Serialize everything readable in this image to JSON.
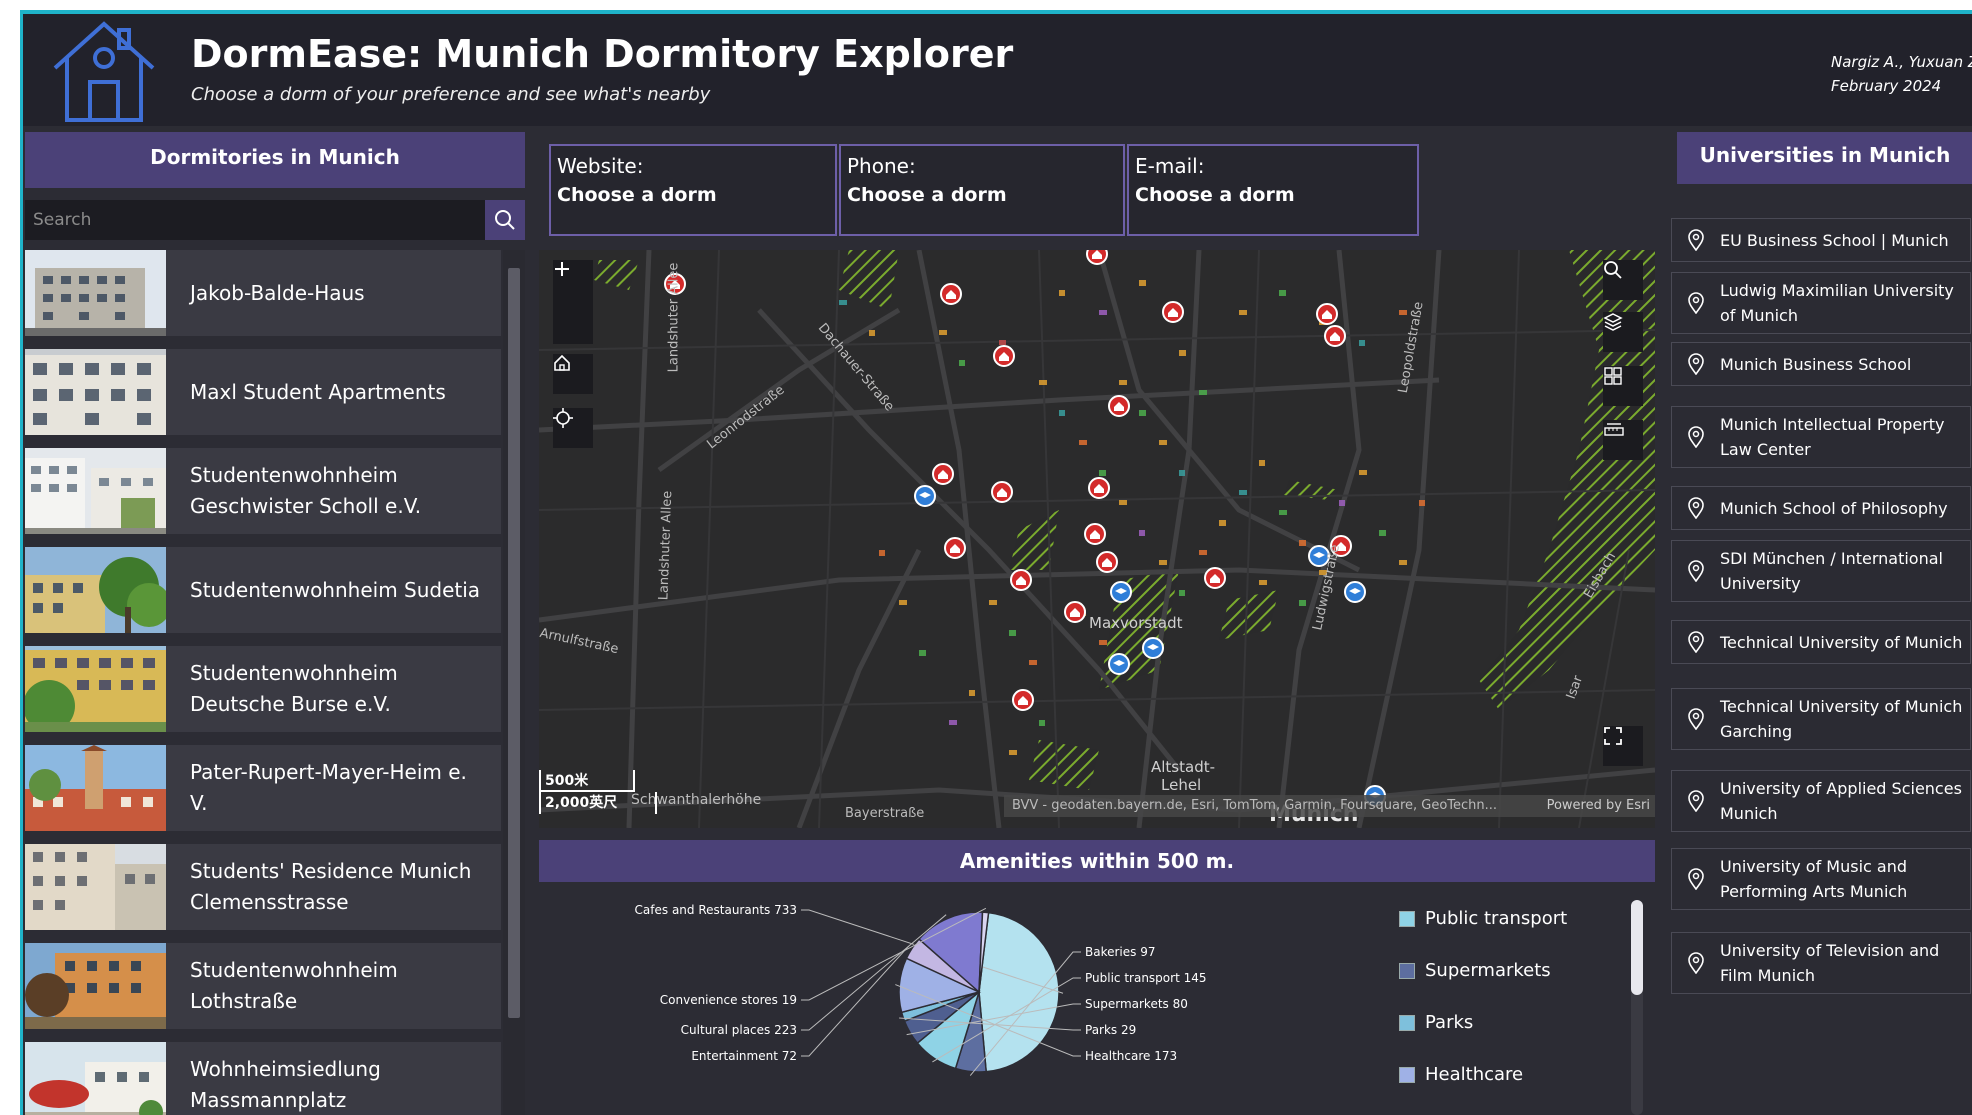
{
  "header": {
    "title": "DormEase: Munich Dormitory Explorer",
    "subtitle": "Choose a dorm of your preference and see what's nearby",
    "authors": "Nargiz A., Yuxuan Zh",
    "date": "February 2024"
  },
  "dorms": {
    "heading": "Dormitories in Munich",
    "search_placeholder": "Search",
    "items": [
      {
        "label": "Jakob-Balde-Haus"
      },
      {
        "label": "Maxl Student Apartments"
      },
      {
        "label": "Studentenwohnheim Geschwister Scholl e.V."
      },
      {
        "label": "Studentenwohnheim Sudetia"
      },
      {
        "label": "Studentenwohnheim Deutsche Burse e.V."
      },
      {
        "label": "Pater-Rupert-Mayer-Heim e. V."
      },
      {
        "label": "Students' Residence Munich Clemensstrasse"
      },
      {
        "label": "Studentenwohnheim Lothstraße"
      },
      {
        "label": "Wohnheimsiedlung Massmannplatz"
      }
    ]
  },
  "info": {
    "website_label": "Website:",
    "website_value": "Choose a dorm",
    "phone_label": "Phone:",
    "phone_value": "Choose a dorm",
    "email_label": "E-mail:",
    "email_value": "Choose a dorm"
  },
  "map": {
    "attribution": "BVV - geodaten.bayern.de, Esri, TomTom, Garmin, Foursquare, GeoTechn...",
    "powered_by": "Powered by Esri",
    "scale_metric": "500米",
    "scale_imperial": "2,000英尺",
    "labels": {
      "maxvorstadt": "Maxvorstadt",
      "altstadt": "Altstadt-",
      "lehel": "Lehel",
      "munich": "Munich",
      "schwanthalerhoehe": "Schwanthalerhöhe",
      "bayerstrasse": "Bayerstraße",
      "arnulfstrasse": "Arnulfstraße",
      "dachauer": "Dachauer-Straße",
      "leonrod": "Leonrodstraße",
      "landshuter1": "Landshuter Allee",
      "landshuter2": "Landshuter Allee",
      "leopold": "Leopoldstraße",
      "ludwig": "Ludwigstraße",
      "isar": "Isar",
      "eisbach": "Eisbach"
    }
  },
  "amenities": {
    "heading": "Amenities within 500 m.",
    "legend": [
      {
        "label": "Public transport",
        "color": "#8fd3e6"
      },
      {
        "label": "Supermarkets",
        "color": "#5d6ea0"
      },
      {
        "label": "Parks",
        "color": "#7ec0dc"
      },
      {
        "label": "Healthcare",
        "color": "#9fb1e6"
      }
    ]
  },
  "chart_data": {
    "type": "pie",
    "title": "Amenities within 500 m.",
    "categories": [
      "Cafes and Restaurants",
      "Bakeries",
      "Public transport",
      "Supermarkets",
      "Parks",
      "Healthcare",
      "Entertainment",
      "Cultural places",
      "Convenience stores"
    ],
    "values": [
      733,
      97,
      145,
      80,
      29,
      173,
      72,
      223,
      19
    ],
    "data_labels": [
      "Cafes and Restaurants 733",
      "Bakeries 97",
      "Public transport 145",
      "Supermarkets 80",
      "Parks 29",
      "Healthcare 173",
      "Entertainment 72",
      "Cultural places 223",
      "Convenience stores 19"
    ],
    "colors": [
      "#b4e2ef",
      "#5d6ea0",
      "#8fd3e6",
      "#4f5f90",
      "#7ec0dc",
      "#9fb1e6",
      "#c3b7e3",
      "#7f7ad0",
      "#d8d4f0"
    ],
    "legend_position": "right"
  },
  "universities": {
    "heading": "Universities in Munich",
    "items": [
      {
        "label": "EU Business School | Munich"
      },
      {
        "label": "Ludwig Maximilian University of Munich"
      },
      {
        "label": "Munich Business School"
      },
      {
        "label": "Munich Intellectual Property Law Center"
      },
      {
        "label": "Munich School of Philosophy"
      },
      {
        "label": "SDI München / International University"
      },
      {
        "label": "Technical University of Munich"
      },
      {
        "label": "Technical University of Munich Garching"
      },
      {
        "label": "University of Applied Sciences Munich"
      },
      {
        "label": "University of Music and Performing Arts Munich"
      },
      {
        "label": "University of Television and Film Munich"
      }
    ]
  },
  "icons": [
    "home-logo-icon",
    "search-icon",
    "zoom-in-icon",
    "zoom-out-icon",
    "home-icon",
    "locate-icon",
    "layers-icon",
    "basemap-gallery-icon",
    "measure-icon",
    "fullscreen-icon",
    "pin-icon",
    "dorm-marker-icon",
    "university-marker-icon"
  ],
  "colors": {
    "accent": "#4b4178",
    "border": "#1fb3c9",
    "dorm_marker": "#d32a2a",
    "university_marker": "#2f7ed8"
  }
}
